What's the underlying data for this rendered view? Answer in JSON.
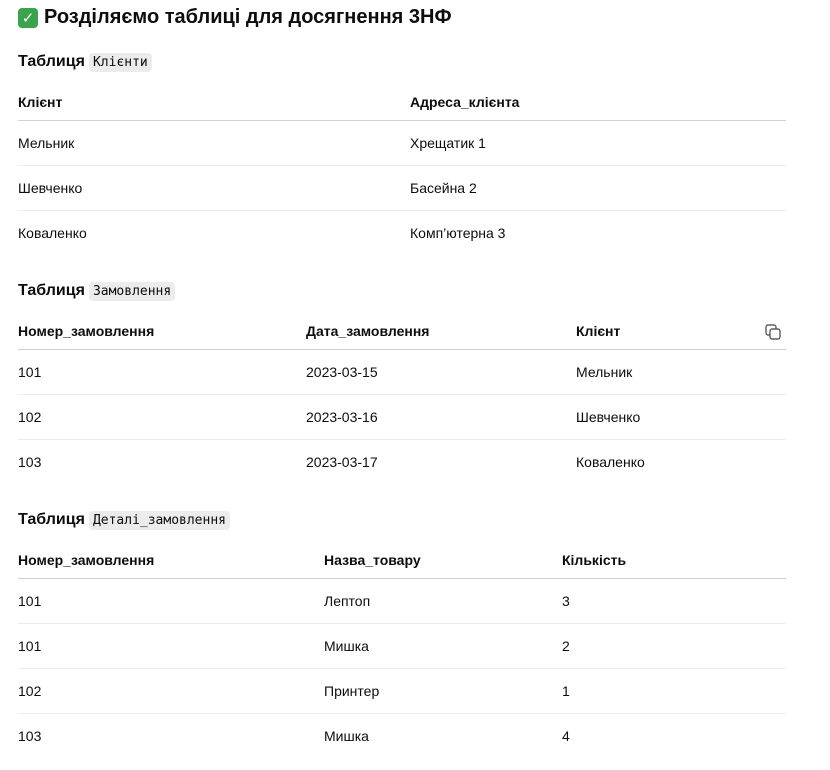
{
  "title": "Розділяємо таблиці для досягнення 3НФ",
  "check_icon": "white-heavy-check-mark",
  "tables": [
    {
      "label": "Таблиця",
      "name": "Клієнти",
      "columns": [
        "Клієнт",
        "Адреса_клієнта"
      ],
      "rows": [
        [
          "Мельник",
          "Хрещатик 1"
        ],
        [
          "Шевченко",
          "Басейна 2"
        ],
        [
          "Коваленко",
          "Комп’ютерна 3"
        ]
      ]
    },
    {
      "label": "Таблиця",
      "name": "Замовлення",
      "columns": [
        "Номер_замовлення",
        "Дата_замовлення",
        "Клієнт"
      ],
      "rows": [
        [
          "101",
          "2023-03-15",
          "Мельник"
        ],
        [
          "102",
          "2023-03-16",
          "Шевченко"
        ],
        [
          "103",
          "2023-03-17",
          "Коваленко"
        ]
      ]
    },
    {
      "label": "Таблиця",
      "name": "Деталі_замовлення",
      "columns": [
        "Номер_замовлення",
        "Назва_товару",
        "Кількість"
      ],
      "rows": [
        [
          "101",
          "Лептоп",
          "3"
        ],
        [
          "101",
          "Мишка",
          "2"
        ],
        [
          "102",
          "Принтер",
          "1"
        ],
        [
          "103",
          "Мишка",
          "4"
        ]
      ]
    }
  ]
}
